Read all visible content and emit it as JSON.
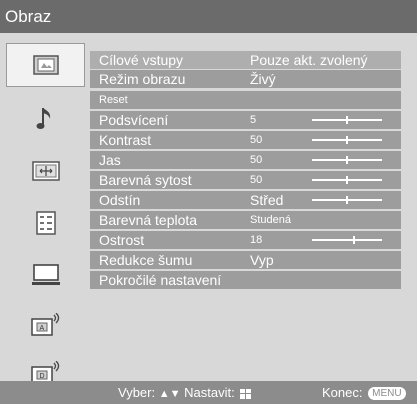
{
  "header": {
    "title": "Obraz"
  },
  "sidebar": {
    "items": [
      {
        "icon": "picture-icon",
        "selected": true
      },
      {
        "icon": "sound-note-icon",
        "selected": false
      },
      {
        "icon": "screen-format-icon",
        "selected": false
      },
      {
        "icon": "settings-list-icon",
        "selected": false
      },
      {
        "icon": "monitor-icon",
        "selected": false
      },
      {
        "icon": "analog-broadcast-icon",
        "selected": false
      },
      {
        "icon": "digital-broadcast-icon",
        "selected": false
      }
    ]
  },
  "menu": {
    "rows": [
      {
        "label": "Cílové vstupy",
        "value": "Pouze akt. zvolený"
      },
      {
        "label": "Režim obrazu",
        "value": "Živý"
      },
      {
        "label": "Reset",
        "value": ""
      },
      {
        "label": "Podsvícení",
        "value": "5",
        "slider_level": 0.5
      },
      {
        "label": "Kontrast",
        "value": "50",
        "slider_level": 0.5
      },
      {
        "label": "Jas",
        "value": "50",
        "slider_level": 0.5
      },
      {
        "label": "Barevná sytost",
        "value": "50",
        "slider_level": 0.5
      },
      {
        "label": "Odstín",
        "value": "Střed",
        "slider_level": 0.5
      },
      {
        "label": "Barevná teplota",
        "value": "Studená"
      },
      {
        "label": "Ostrost",
        "value": "18",
        "slider_level": 0.6
      },
      {
        "label": "Redukce šumu",
        "value": "Vyp"
      },
      {
        "label": "Pokročilé nastavení",
        "value": ""
      }
    ]
  },
  "status": {
    "select_label": "Vyber:",
    "set_label": "Nastavit:",
    "exit_label": "Konec:",
    "menu_key": "MENU"
  },
  "colors": {
    "title_bar": "#6b6b6b",
    "row_bg": "#9d9d9d",
    "panel_bg": "#d8d8d8",
    "text": "#ffffff"
  }
}
